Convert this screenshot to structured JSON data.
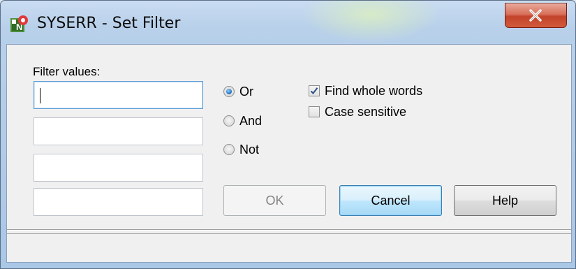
{
  "window": {
    "title": "SYSERR - Set Filter",
    "app_icon": "syserr-app-icon",
    "close_icon": "close-icon"
  },
  "filter": {
    "label": "Filter values:",
    "values": [
      "",
      "",
      "",
      ""
    ]
  },
  "logic": {
    "options": [
      {
        "label": "Or",
        "selected": true
      },
      {
        "label": "And",
        "selected": false
      },
      {
        "label": "Not",
        "selected": false
      }
    ]
  },
  "options": {
    "find_whole_words": {
      "label": "Find whole words",
      "checked": true
    },
    "case_sensitive": {
      "label": "Case sensitive",
      "checked": false
    }
  },
  "buttons": {
    "ok": {
      "label": "OK",
      "enabled": false
    },
    "cancel": {
      "label": "Cancel",
      "default": true
    },
    "help": {
      "label": "Help"
    }
  },
  "colors": {
    "close_button": "#c2432a",
    "radio_selected": "#2a79c4",
    "focus_border": "#5d9fd6"
  }
}
